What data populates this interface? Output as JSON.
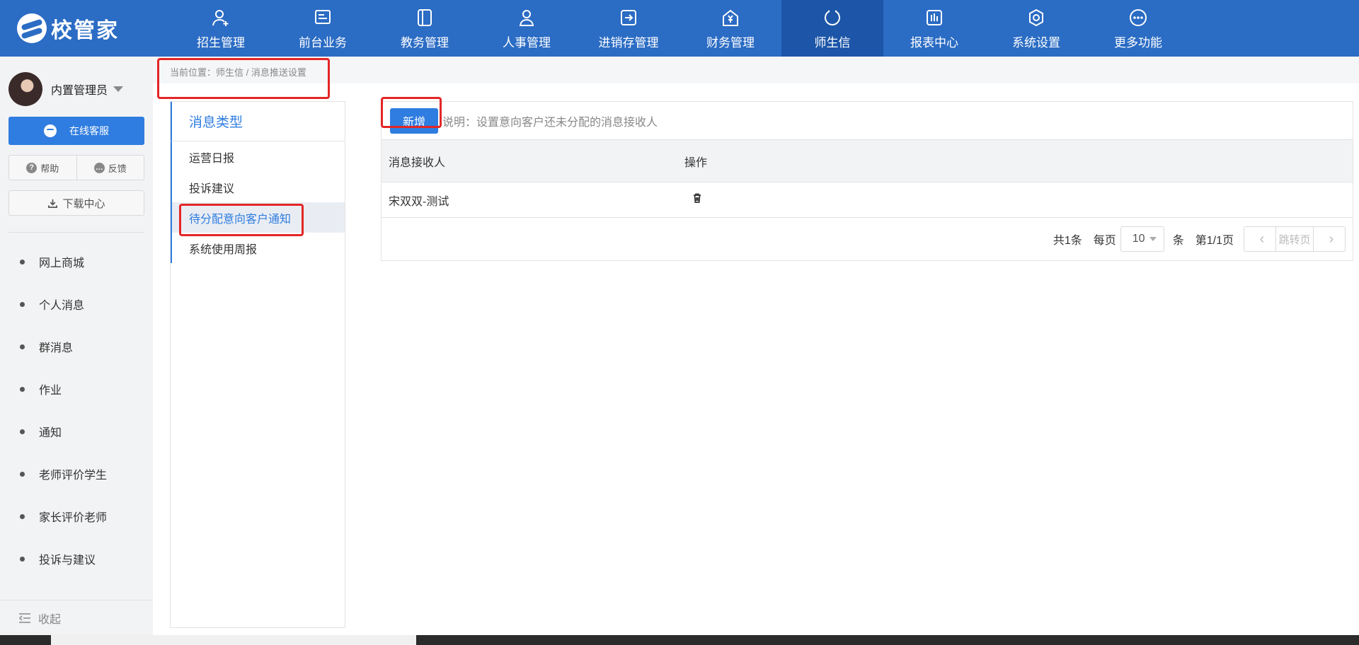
{
  "app": {
    "logo_text": "校管家"
  },
  "nav": [
    {
      "label": "招生管理",
      "icon": "user-add-icon"
    },
    {
      "label": "前台业务",
      "icon": "desk-icon"
    },
    {
      "label": "教务管理",
      "icon": "book-icon"
    },
    {
      "label": "人事管理",
      "icon": "person-icon"
    },
    {
      "label": "进销存管理",
      "icon": "inout-icon"
    },
    {
      "label": "财务管理",
      "icon": "yuan-icon"
    },
    {
      "label": "师生信",
      "icon": "refresh-icon",
      "active": true
    },
    {
      "label": "报表中心",
      "icon": "chart-icon"
    },
    {
      "label": "系统设置",
      "icon": "gear-icon"
    },
    {
      "label": "更多功能",
      "icon": "more-icon"
    }
  ],
  "sidebar": {
    "user_name": "内置管理员",
    "service_label": "在线客服",
    "help_label": "帮助",
    "feedback_label": "反馈",
    "download_label": "下载中心",
    "items": [
      "网上商城",
      "个人消息",
      "群消息",
      "作业",
      "通知",
      "老师评价学生",
      "家长评价老师",
      "投诉与建议"
    ],
    "collapse_label": "收起"
  },
  "breadcrumb": "当前位置：师生信 / 消息推送设置",
  "types": {
    "title": "消息类型",
    "items": [
      "运营日报",
      "投诉建议",
      "待分配意向客户通知",
      "系统使用周报"
    ],
    "active_index": 2
  },
  "content": {
    "add_label": "新增",
    "note": "说明：设置意向客户还未分配的消息接收人",
    "columns": [
      "消息接收人",
      "操作"
    ],
    "rows": [
      {
        "recipient": "宋双双-测试"
      }
    ],
    "pager": {
      "total": "共1条",
      "per_page_label": "每页",
      "per_page": "10",
      "unit": "条",
      "page": "第1/1页",
      "jump_label": "跳转页"
    }
  },
  "colors": {
    "nav_bg": "#2b6cc4",
    "nav_active": "#1d56a8",
    "accent": "#2f7de0",
    "highlight_box": "#e32626"
  }
}
